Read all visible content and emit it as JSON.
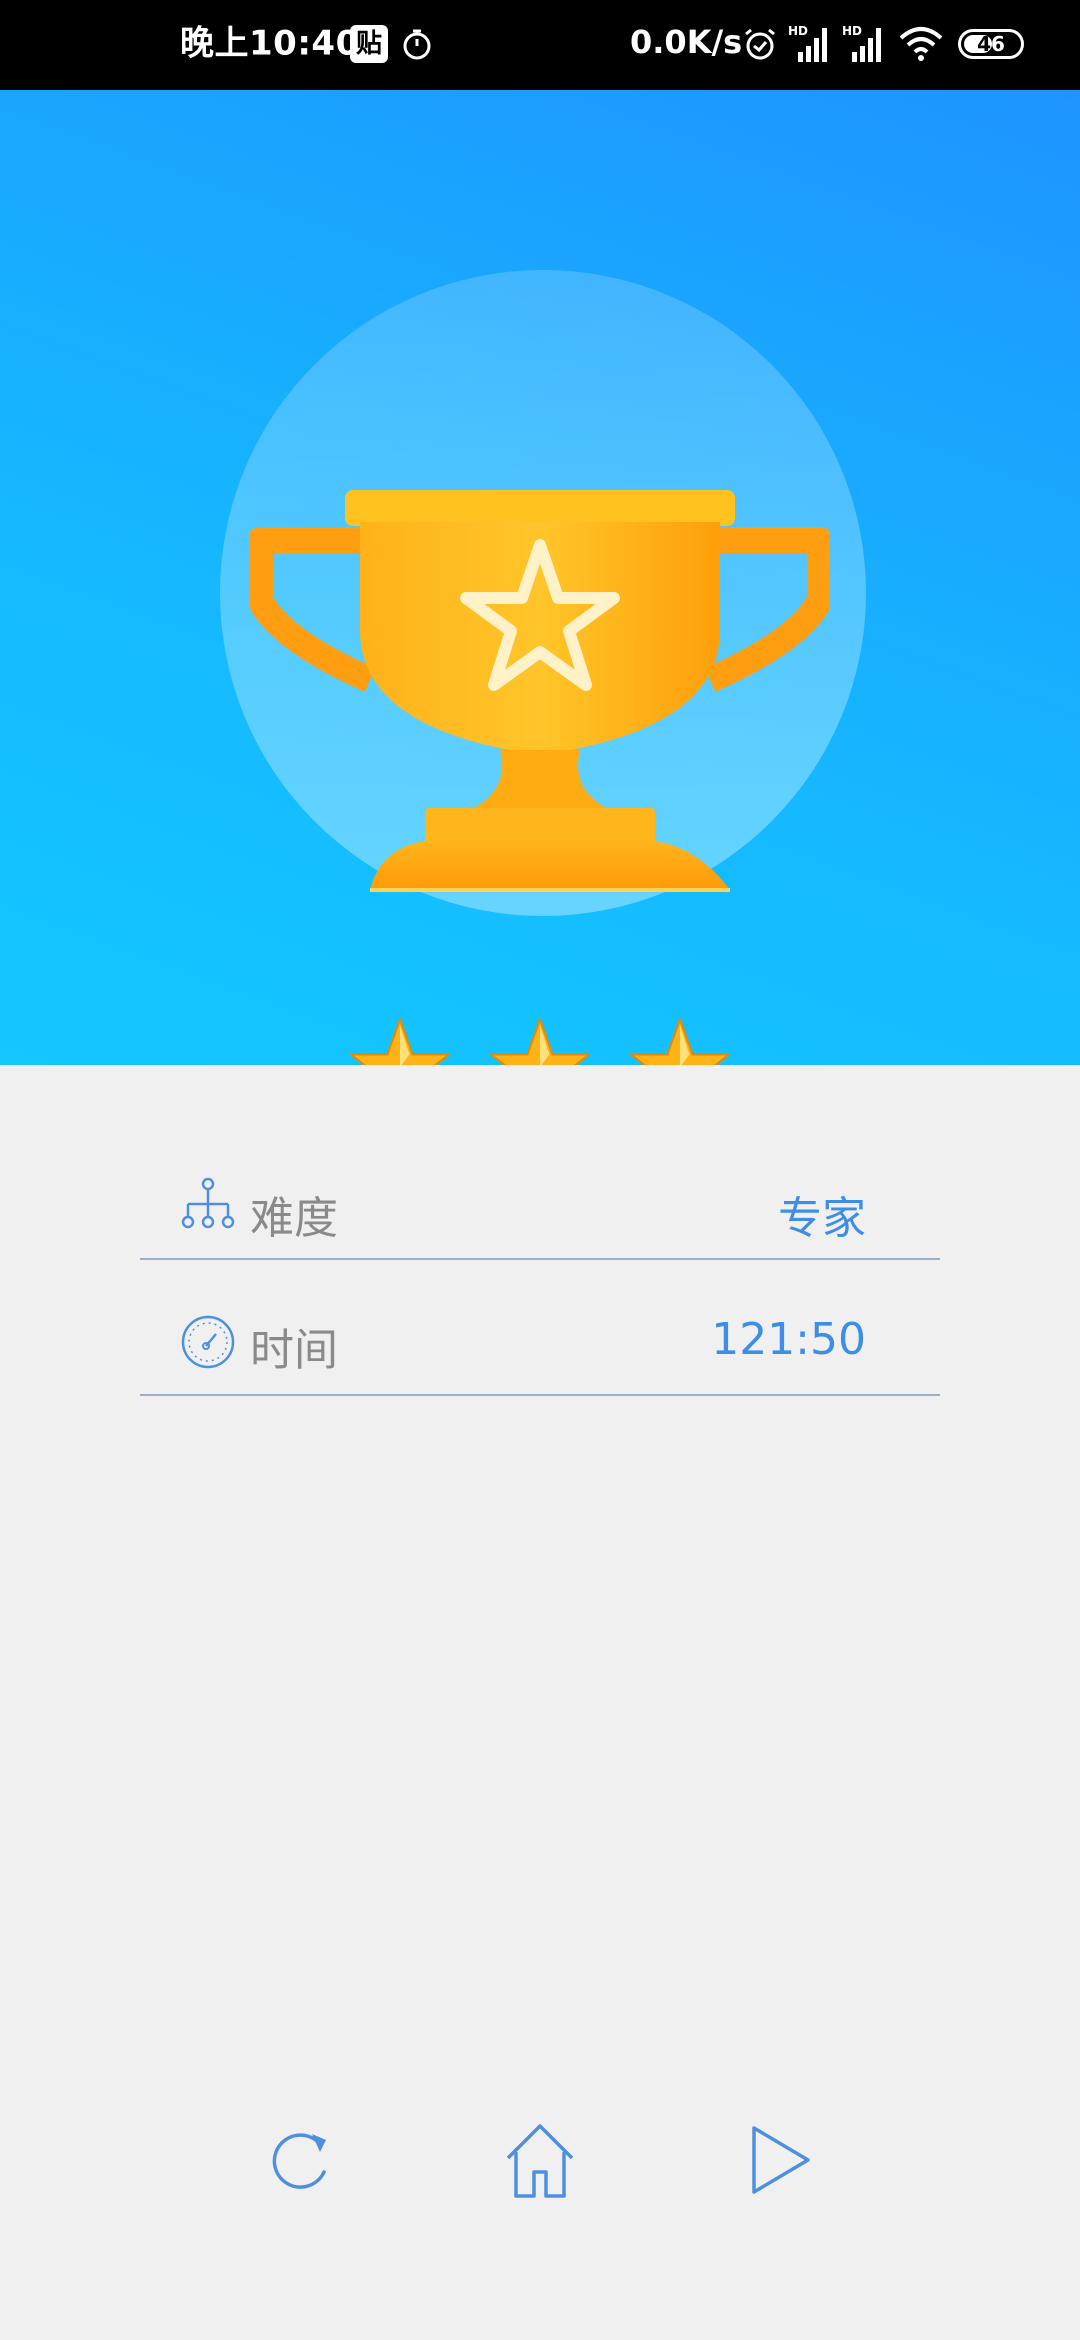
{
  "status_bar": {
    "time": "晚上10:40",
    "notification_badge": "贴",
    "network_speed": "0.0K/s",
    "signal_label_1": "HD",
    "signal_label_2": "HD",
    "battery": "46",
    "battery_level": 0.46
  },
  "result": {
    "stars_earned": 3,
    "stars_total": 3
  },
  "details": {
    "difficulty_label": "难度",
    "difficulty_value": "专家",
    "time_label": "时间",
    "time_value": "121:50"
  },
  "actions": {
    "restart_icon": "refresh-icon",
    "home_icon": "home-icon",
    "next_icon": "play-icon"
  },
  "colors": {
    "accent": "#3d8ee4",
    "hero_top": "#1e94ff",
    "hero_bottom": "#12c8ff",
    "trophy": "#ffa90f",
    "background": "#f0f0f1"
  }
}
